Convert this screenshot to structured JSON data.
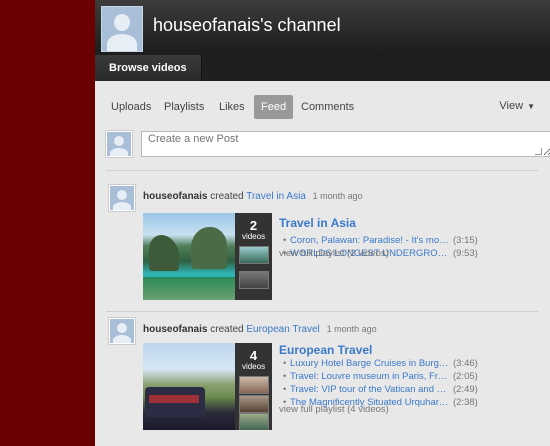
{
  "channel": {
    "title": "houseofanais's channel"
  },
  "nav": {
    "browse_label": "Browse videos"
  },
  "tabs": [
    {
      "label": "Uploads",
      "active": false
    },
    {
      "label": "Playlists",
      "active": false
    },
    {
      "label": "Likes",
      "active": false
    },
    {
      "label": "Feed",
      "active": true
    },
    {
      "label": "Comments",
      "active": false
    }
  ],
  "view_menu": {
    "label": "View"
  },
  "post": {
    "placeholder": "Create a new Post"
  },
  "feed": [
    {
      "user": "houseofanais",
      "action": "created",
      "playlist": "Travel in Asia",
      "ago": "1 month ago",
      "count": "2",
      "count_label": "videos",
      "videos": [
        {
          "title": "Coron, Palawan: Paradise! - It's more fu...",
          "duration": "(3:15)"
        },
        {
          "title": "WORLDS LONGEST UNDERGROUND...",
          "duration": "(9:53)"
        }
      ],
      "view_full": "view full playlist (2 videos)"
    },
    {
      "user": "houseofanais",
      "action": "created",
      "playlist": "European Travel",
      "ago": "1 month ago",
      "count": "4",
      "count_label": "videos",
      "videos": [
        {
          "title": "Luxury Hotel Barge Cruises in Burgund...",
          "duration": "(3:46)"
        },
        {
          "title": "Travel: Louvre museum in Paris, France",
          "duration": "(2:05)"
        },
        {
          "title": "Travel: VIP tour of the Vatican and Vatic...",
          "duration": "(2:49)"
        },
        {
          "title": "The Magnificently Situated Urquhart Ca...",
          "duration": "(2:38)"
        }
      ],
      "view_full": "view full playlist (4 videos)"
    }
  ],
  "colors": {
    "background": "#6b0000",
    "link": "#3b79c9",
    "panel": "#e8e8e8"
  }
}
